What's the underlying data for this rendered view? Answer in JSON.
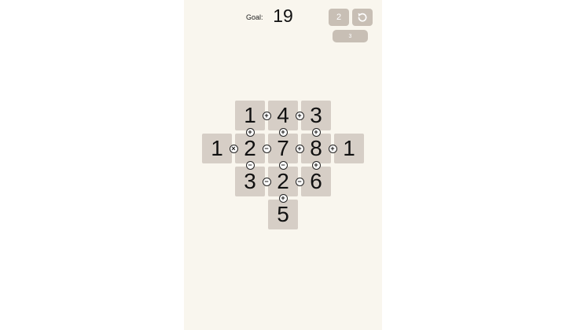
{
  "header": {
    "goal_label": "Goal:",
    "goal_value": "19",
    "hint_count": "2",
    "undo_icon": "undo-icon",
    "level": "3"
  },
  "colors": {
    "background": "#f9f6ee",
    "tile": "#d6cec6",
    "button": "#c8bfb5"
  },
  "board": {
    "tiles": [
      {
        "row": 0,
        "col": 1,
        "value": "1"
      },
      {
        "row": 0,
        "col": 2,
        "value": "4"
      },
      {
        "row": 0,
        "col": 3,
        "value": "3"
      },
      {
        "row": 1,
        "col": 0,
        "value": "1"
      },
      {
        "row": 1,
        "col": 1,
        "value": "2"
      },
      {
        "row": 1,
        "col": 2,
        "value": "7"
      },
      {
        "row": 1,
        "col": 3,
        "value": "8"
      },
      {
        "row": 1,
        "col": 4,
        "value": "1"
      },
      {
        "row": 2,
        "col": 1,
        "value": "3"
      },
      {
        "row": 2,
        "col": 2,
        "value": "2"
      },
      {
        "row": 2,
        "col": 3,
        "value": "6"
      },
      {
        "row": 3,
        "col": 2,
        "value": "5"
      }
    ],
    "operators": [
      {
        "from": [
          0,
          1
        ],
        "to": [
          0,
          2
        ],
        "symbol": "+"
      },
      {
        "from": [
          0,
          2
        ],
        "to": [
          0,
          3
        ],
        "symbol": "+"
      },
      {
        "from": [
          0,
          1
        ],
        "to": [
          1,
          1
        ],
        "symbol": "+"
      },
      {
        "from": [
          0,
          2
        ],
        "to": [
          1,
          2
        ],
        "symbol": "+"
      },
      {
        "from": [
          0,
          3
        ],
        "to": [
          1,
          3
        ],
        "symbol": "+"
      },
      {
        "from": [
          1,
          0
        ],
        "to": [
          1,
          1
        ],
        "symbol": "×"
      },
      {
        "from": [
          1,
          1
        ],
        "to": [
          1,
          2
        ],
        "symbol": "−"
      },
      {
        "from": [
          1,
          2
        ],
        "to": [
          1,
          3
        ],
        "symbol": "+"
      },
      {
        "from": [
          1,
          3
        ],
        "to": [
          1,
          4
        ],
        "symbol": "+"
      },
      {
        "from": [
          1,
          1
        ],
        "to": [
          2,
          1
        ],
        "symbol": "−"
      },
      {
        "from": [
          1,
          2
        ],
        "to": [
          2,
          2
        ],
        "symbol": "−"
      },
      {
        "from": [
          1,
          3
        ],
        "to": [
          2,
          3
        ],
        "symbol": "+"
      },
      {
        "from": [
          2,
          1
        ],
        "to": [
          2,
          2
        ],
        "symbol": "−"
      },
      {
        "from": [
          2,
          2
        ],
        "to": [
          2,
          3
        ],
        "symbol": "−"
      },
      {
        "from": [
          2,
          2
        ],
        "to": [
          3,
          2
        ],
        "symbol": "+"
      }
    ]
  }
}
